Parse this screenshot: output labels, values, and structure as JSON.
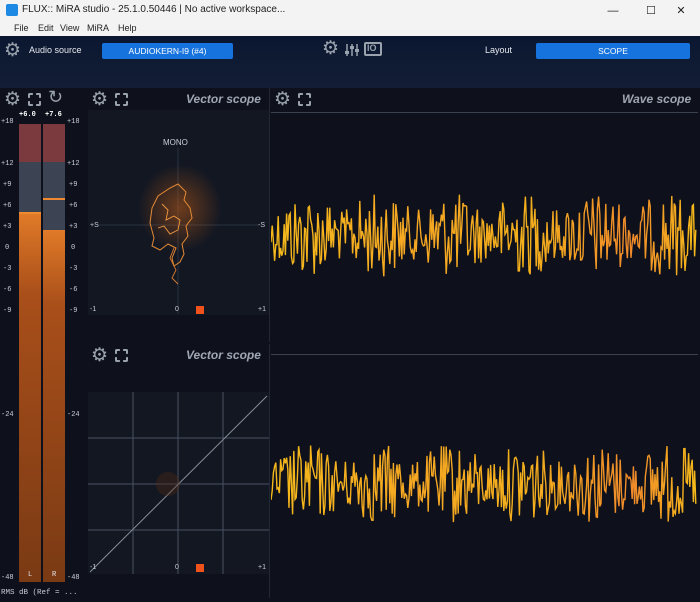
{
  "window": {
    "title": "FLUX:: MiRA studio - 25.1.0.50446 | No active workspace...",
    "minimize": "—",
    "maximize": "☐",
    "close": "✕"
  },
  "menu": [
    "File",
    "Edit",
    "View",
    "MiRA",
    "Help"
  ],
  "toolbar": {
    "audio_source_label": "Audio source",
    "audio_source_value": "AUDIOKERN-I9 (#4)",
    "layout_label": "Layout",
    "layout_value": "SCOPE",
    "io_label": "IO"
  },
  "meter": {
    "peak_left": "+6.0",
    "peak_right": "+7.6",
    "scale": [
      "+18",
      "+12",
      "+9",
      "+6",
      "+3",
      "0",
      "-3",
      "-6",
      "-9",
      "-24",
      "-48"
    ],
    "channel_left": "L",
    "channel_right": "R",
    "footer": "RMS dB (Ref = ..."
  },
  "vector_scope_1": {
    "title": "Vector scope",
    "mono_label": "MONO",
    "left_tick": "+S",
    "right_tick": "-S",
    "x_ticks": [
      "-1",
      "0",
      "+1"
    ]
  },
  "vector_scope_2": {
    "title": "Vector scope",
    "x_ticks": [
      "-1",
      "0",
      "+1"
    ]
  },
  "wave_scope": {
    "title": "Wave scope"
  },
  "colors": {
    "accent_blue": "#1673de",
    "wave_orange": "#f5a623",
    "meter_orange": "#c0601a"
  }
}
